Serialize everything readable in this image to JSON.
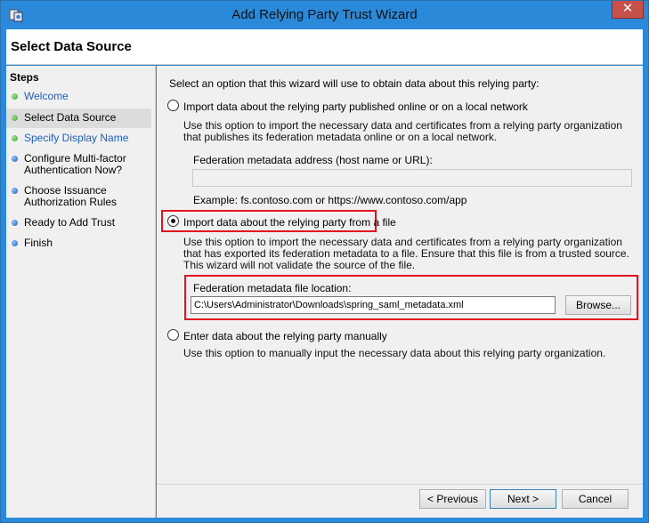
{
  "window": {
    "title": "Add Relying Party Trust Wizard",
    "close_glyph": "✕"
  },
  "header": {
    "title": "Select Data Source"
  },
  "steps": {
    "heading": "Steps",
    "items": [
      {
        "label": "Welcome",
        "status": "done",
        "dot_color": "#3aa531"
      },
      {
        "label": "Select Data Source",
        "status": "current",
        "dot_color": "#3aa531"
      },
      {
        "label": "Specify Display Name",
        "status": "done",
        "dot_color": "#3aa531"
      },
      {
        "label": "Configure Multi-factor Authentication Now?",
        "status": "pending",
        "dot_color": "#1b5fc0"
      },
      {
        "label": "Choose Issuance Authorization Rules",
        "status": "pending",
        "dot_color": "#1b5fc0"
      },
      {
        "label": "Ready to Add Trust",
        "status": "pending",
        "dot_color": "#1b5fc0"
      },
      {
        "label": "Finish",
        "status": "pending",
        "dot_color": "#1b5fc0"
      }
    ]
  },
  "main": {
    "intro": "Select an option that this wizard will use to obtain data about this relying party:",
    "option_online": {
      "label": "Import data about the relying party published online or on a local network",
      "description": "Use this option to import the necessary data and certificates from a relying party organization that publishes its federation metadata online or on a local network.",
      "address_label": "Federation metadata address (host name or URL):",
      "address_value": "",
      "example": "Example: fs.contoso.com or https://www.contoso.com/app",
      "selected": false
    },
    "option_file": {
      "label": "Import data about the relying party from a file",
      "description": "Use this option to import the necessary data and certificates from a relying party organization that has exported its federation metadata to a file. Ensure that this file is from a trusted source.  This wizard will not validate the source of the file.",
      "file_label": "Federation metadata file location:",
      "file_value": "C:\\Users\\Administrator\\Downloads\\spring_saml_metadata.xml",
      "browse_label": "Browse...",
      "selected": true
    },
    "option_manual": {
      "label": "Enter data about the relying party manually",
      "description": "Use this option to manually input the necessary data about this relying party organization.",
      "selected": false
    }
  },
  "footer": {
    "previous_label": "< Previous",
    "next_label": "Next >",
    "cancel_label": "Cancel"
  },
  "colors": {
    "titlebar": "#2b89d9",
    "highlight_box": "#e0151f",
    "link": "#1f5fbf"
  }
}
